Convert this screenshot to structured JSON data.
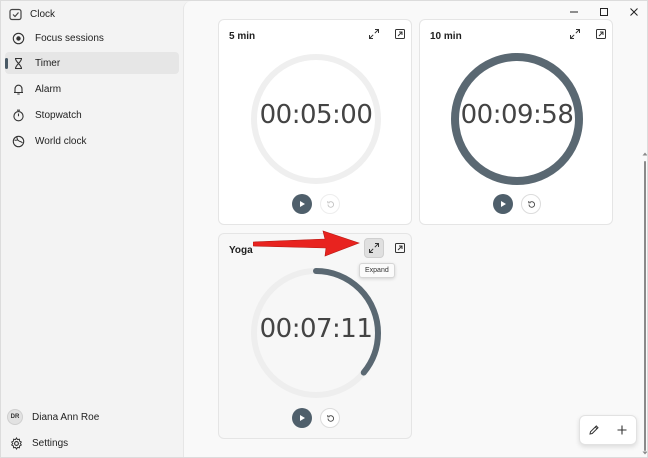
{
  "app": {
    "title": "Clock"
  },
  "sidebar": {
    "items": [
      {
        "label": "Focus sessions",
        "icon": "focus-icon"
      },
      {
        "label": "Timer",
        "icon": "hourglass-icon",
        "active": true
      },
      {
        "label": "Alarm",
        "icon": "bell-icon"
      },
      {
        "label": "Stopwatch",
        "icon": "stopwatch-icon"
      },
      {
        "label": "World clock",
        "icon": "globe-icon"
      }
    ],
    "user": {
      "initials": "DR",
      "name": "Diana Ann Roe"
    },
    "settings_label": "Settings"
  },
  "timers": [
    {
      "name": "5 min",
      "time": "00:05:00",
      "progress": 1.0,
      "running": false
    },
    {
      "name": "10 min",
      "time": "00:09:58",
      "progress": 0.997,
      "running": false
    },
    {
      "name": "Yoga",
      "time": "00:07:11",
      "progress": 0.36,
      "running": false
    }
  ],
  "tooltip": {
    "text": "Expand"
  },
  "colors": {
    "accent": "#4f5f6b",
    "ring_track": "#efefef",
    "arrow": "#e8231f"
  }
}
